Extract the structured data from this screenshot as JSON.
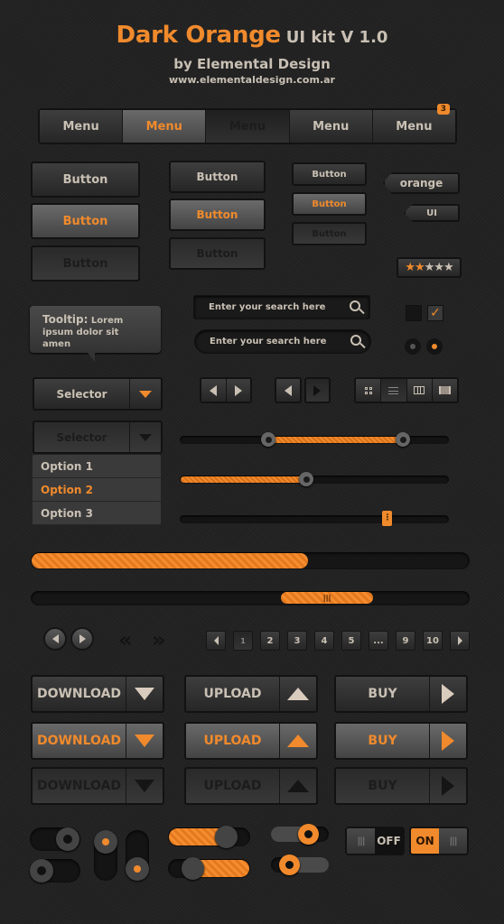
{
  "header": {
    "title_brand": "Dark Orange",
    "title_rest": "UI kit V 1.0",
    "subtitle": "by Elemental Design",
    "url": "www.elementaldesign.com.ar"
  },
  "colors": {
    "accent": "#f08a2c",
    "text": "#c9c0b4",
    "background": "#232323"
  },
  "menu": {
    "items": [
      {
        "label": "Menu",
        "state": "normal"
      },
      {
        "label": "Menu",
        "state": "active"
      },
      {
        "label": "Menu",
        "state": "pressed"
      },
      {
        "label": "Menu",
        "state": "normal"
      },
      {
        "label": "Menu",
        "state": "normal",
        "badge": "3"
      }
    ]
  },
  "buttons": {
    "large": [
      "Button",
      "Button",
      "Button"
    ],
    "medium": [
      "Button",
      "Button",
      "Button"
    ],
    "small": [
      "Button",
      "Button",
      "Button"
    ]
  },
  "tags": [
    "orange",
    "UI"
  ],
  "rating": {
    "value": 2,
    "max": 5,
    "star": "★"
  },
  "tooltip": {
    "title": "Tooltip:",
    "text": "Lorem ipsum dolor sit amen"
  },
  "search": [
    {
      "placeholder": "Enter your search here"
    },
    {
      "placeholder": "Enter your search here"
    }
  ],
  "checkboxes": [
    {
      "checked": false
    },
    {
      "checked": true,
      "mark": "✓"
    }
  ],
  "radios": [
    {
      "selected": false
    },
    {
      "selected": true
    }
  ],
  "selectors": [
    {
      "label": "Selector",
      "state": "normal"
    },
    {
      "label": "Selector",
      "state": "open"
    }
  ],
  "dropdown_options": [
    {
      "label": "Option 1",
      "active": false
    },
    {
      "label": "Option 2",
      "active": true
    },
    {
      "label": "Option 3",
      "active": false
    }
  ],
  "view_toggles": [
    "grid-view",
    "list-view",
    "column-view",
    "filmstrip-view"
  ],
  "sliders": {
    "range": {
      "low": 0.33,
      "high": 0.83
    },
    "single": {
      "value": 0.47
    },
    "handle": {
      "value": 0.77
    }
  },
  "progress": {
    "value": 0.63
  },
  "scrollbar": {
    "start": 0.57,
    "end": 0.78
  },
  "pagination": {
    "pages": [
      "1",
      "2",
      "3",
      "4",
      "5",
      "...",
      "9",
      "10"
    ],
    "current": "1"
  },
  "action_buttons": {
    "download": [
      "DOWNLOAD",
      "DOWNLOAD",
      "DOWNLOAD"
    ],
    "upload": [
      "UPLOAD",
      "UPLOAD",
      "UPLOAD"
    ],
    "buy": [
      "BUY",
      "BUY",
      "BUY"
    ]
  },
  "switches": {
    "off_label": "OFF",
    "on_label": "ON",
    "grip": "|||"
  }
}
